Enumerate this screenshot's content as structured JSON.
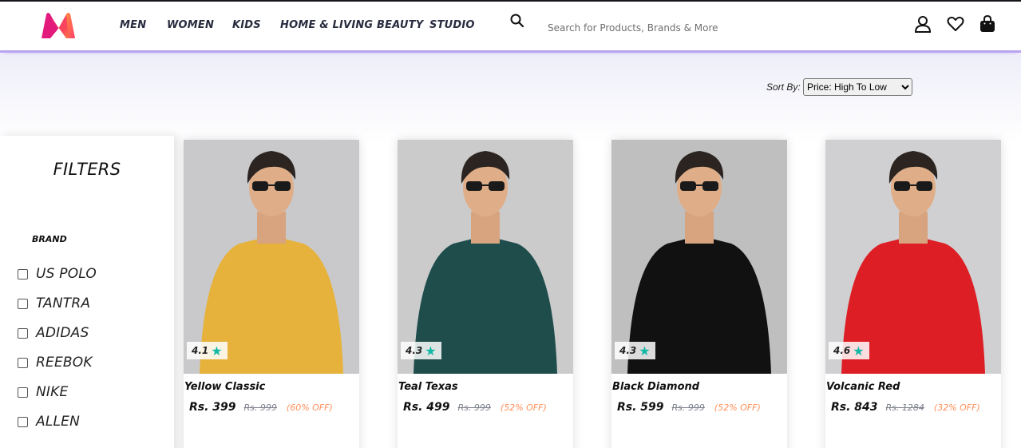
{
  "header": {
    "nav": [
      "MEN",
      "WOMEN",
      "KIDS",
      "HOME & LIVING",
      "BEAUTY",
      "STUDIO"
    ],
    "search_placeholder": "Search for Products, Brands & More",
    "icons": [
      "profile-icon",
      "wishlist-heart-icon",
      "bag-icon"
    ]
  },
  "sort": {
    "label": "Sort By:",
    "selected": "Price: High To Low"
  },
  "filters": {
    "title": "FILTERS",
    "brand_title": "BRAND",
    "brands": [
      "US POLO",
      "TANTRA",
      "ADIDAS",
      "REEBOK",
      "NIKE",
      "ALLEN"
    ]
  },
  "products": [
    {
      "name": "Yellow Classic",
      "rating": "4.1",
      "price": "Rs. 399",
      "mrp": "Rs. 999",
      "discount": "(60% OFF)",
      "shirt_color": "#e6b23c",
      "bg": "#c9c9cb"
    },
    {
      "name": "Teal Texas",
      "rating": "4.3",
      "price": "Rs. 499",
      "mrp": "Rs. 999",
      "discount": "(52% OFF)",
      "shirt_color": "#1f4d4c",
      "bg": "#cbcbcc"
    },
    {
      "name": "Black Diamond",
      "rating": "4.3",
      "price": "Rs. 599",
      "mrp": "Rs. 999",
      "discount": "(52% OFF)",
      "shirt_color": "#111111",
      "bg": "#bfbfc0"
    },
    {
      "name": "Volcanic Red",
      "rating": "4.6",
      "price": "Rs. 843",
      "mrp": "Rs. 1284",
      "discount": "(32% OFF)",
      "shirt_color": "#dd1f25",
      "bg": "#d0d0d2"
    }
  ],
  "colors": {
    "accent": "#b9a4f0",
    "rating_star": "#14b8a6",
    "discount": "#ff905a"
  }
}
